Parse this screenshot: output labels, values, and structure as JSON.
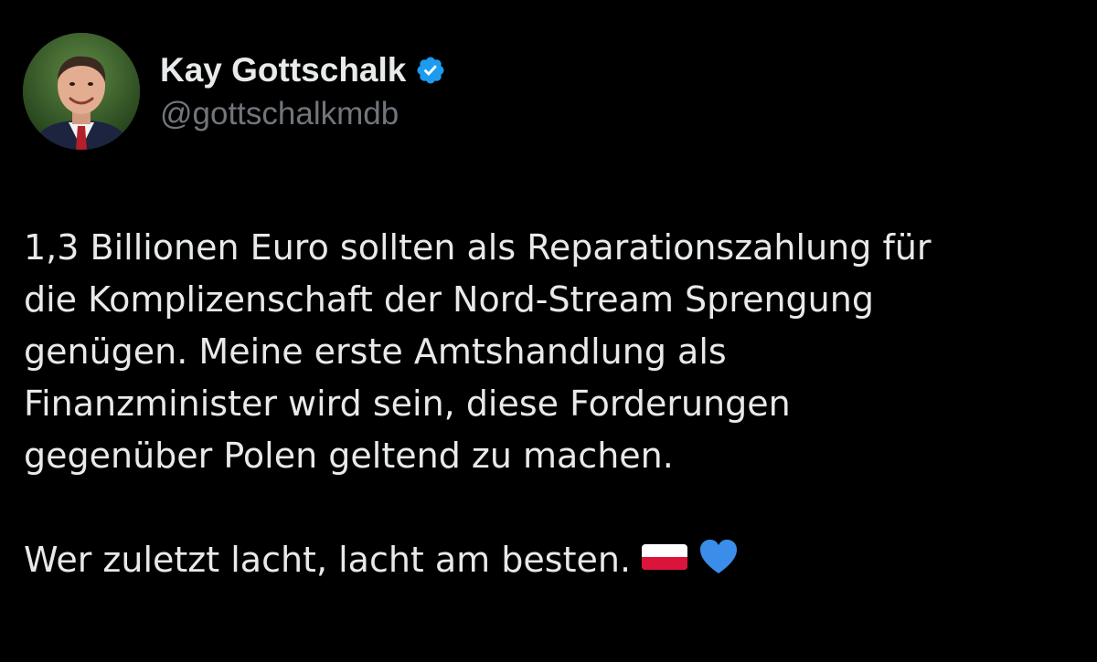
{
  "author": {
    "display_name": "Kay Gottschalk",
    "handle": "@gottschalkmdb",
    "verified": true,
    "verified_icon": "verified-badge-icon",
    "avatar_icon": "profile-photo"
  },
  "post": {
    "paragraph_1": "1,3 Billionen Euro sollten als Reparationszahlung für\ndie Komplizenschaft der Nord-Stream Sprengung\ngenügen. Meine erste Amtshandlung als\nFinanzminister wird sein, diese Forderungen\ngegenüber Polen geltend zu machen.",
    "paragraph_2": "Wer zuletzt lacht, lacht am besten.",
    "emojis": [
      "flag-poland-icon",
      "blue-heart-icon"
    ]
  },
  "colors": {
    "background": "#000000",
    "primary_text": "#e7e9ea",
    "secondary_text": "#71767b",
    "verified_blue": "#1d9bf0",
    "heart_blue": "#3a8eea"
  }
}
